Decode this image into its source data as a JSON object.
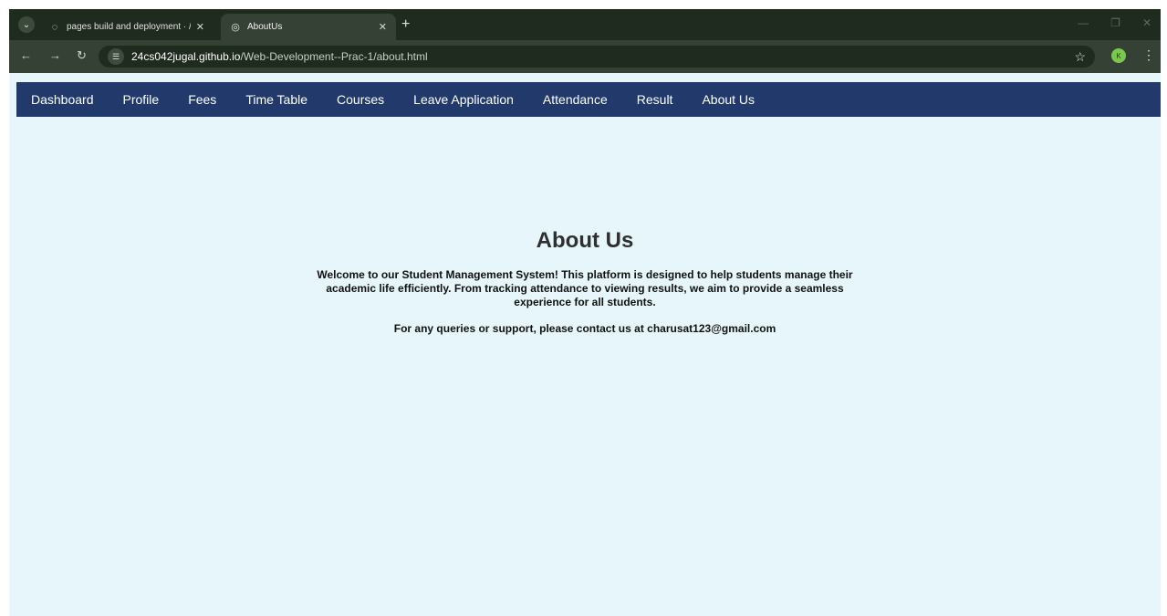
{
  "browser": {
    "tabs": [
      {
        "title": "pages build and deployment · /",
        "active": false
      },
      {
        "title": "AboutUs",
        "active": true
      }
    ],
    "url_host": "24cs042jugal.github.io",
    "url_path": "/Web-Development--Prac-1/about.html",
    "profile_initial": "K"
  },
  "navbar": {
    "items": [
      "Dashboard",
      "Profile",
      "Fees",
      "Time Table",
      "Courses",
      "Leave Application",
      "Attendance",
      "Result",
      "About Us"
    ]
  },
  "content": {
    "heading": "About Us",
    "intro": "Welcome to our Student Management System! This platform is designed to help students manage their academic life efficiently. From tracking attendance to viewing results, we aim to provide a seamless experience for all students.",
    "contact": "For any queries or support, please contact us at charusat123@gmail.com"
  },
  "colors": {
    "navbar_bg": "#223a6b",
    "page_bg": "#e6f6fb"
  }
}
